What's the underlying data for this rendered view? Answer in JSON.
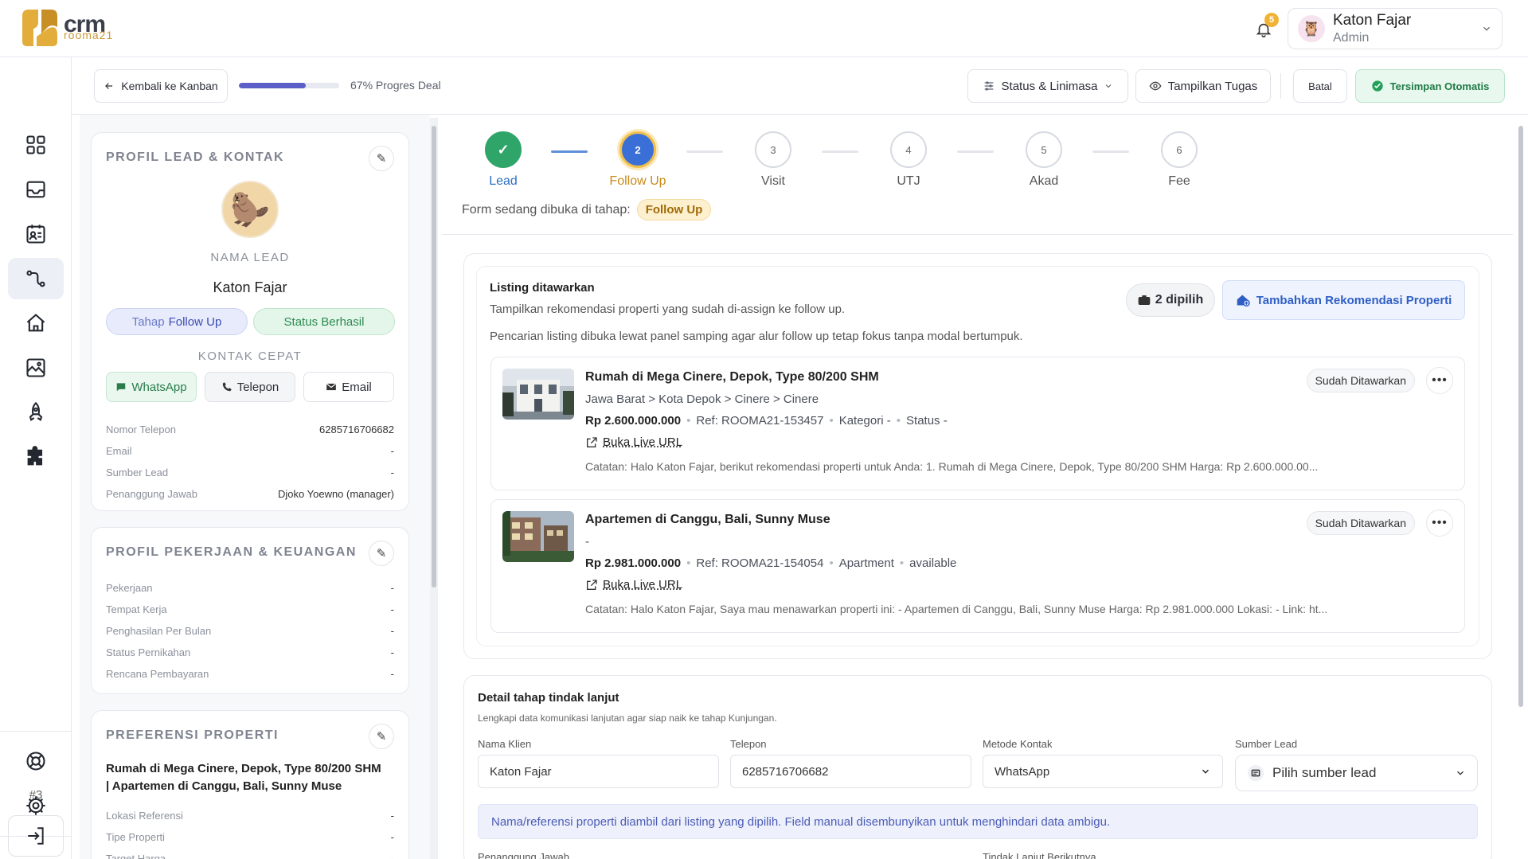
{
  "app": {
    "logo_main": "crm",
    "logo_sub": "rooma21"
  },
  "header": {
    "notif_count": "5",
    "user_name": "Katon Fajar",
    "user_role": "Admin"
  },
  "sidebar": {
    "footer_number": "#3"
  },
  "toolbar": {
    "back_label": "Kembali ke Kanban",
    "progress_percent": 67,
    "progress_label": "67% Progres Deal",
    "status_label": "Status & Linimasa",
    "tasks_label": "Tampilkan Tugas",
    "cancel_label": "Batal",
    "saved_label": "Tersimpan Otomatis"
  },
  "lead_profile": {
    "title": "PROFIL LEAD & KONTAK",
    "name_caption": "NAMA LEAD",
    "name": "Katon Fajar",
    "stage_prefix": "Tahap",
    "stage_value": "Follow Up",
    "status_badge": "Status Berhasil",
    "quick_contact_title": "KONTAK CEPAT",
    "whatsapp": "WhatsApp",
    "telepon": "Telepon",
    "email": "Email",
    "fields": [
      {
        "k": "Nomor Telepon",
        "v": "6285716706682"
      },
      {
        "k": "Email",
        "v": "-"
      },
      {
        "k": "Sumber Lead",
        "v": "-"
      },
      {
        "k": "Penanggung Jawab",
        "v": "Djoko Yoewno (manager)"
      }
    ]
  },
  "job_profile": {
    "title": "PROFIL PEKERJAAN & KEUANGAN",
    "fields": [
      {
        "k": "Pekerjaan",
        "v": "-"
      },
      {
        "k": "Tempat Kerja",
        "v": "-"
      },
      {
        "k": "Penghasilan Per Bulan",
        "v": "-"
      },
      {
        "k": "Status Pernikahan",
        "v": "-"
      },
      {
        "k": "Rencana Pembayaran",
        "v": "-"
      }
    ]
  },
  "property_pref": {
    "title": "PREFERENSI PROPERTI",
    "summary_line1": "Rumah di Mega Cinere, Depok, Type 80/200 SHM",
    "summary_line2": "| Apartemen di Canggu, Bali, Sunny Muse",
    "fields": [
      {
        "k": "Lokasi Referensi",
        "v": "-"
      },
      {
        "k": "Tipe Properti",
        "v": "-"
      },
      {
        "k": "Target Harga",
        "v": "-"
      }
    ]
  },
  "stepper": {
    "steps": [
      {
        "num": "✓",
        "label": "Lead",
        "state": "done"
      },
      {
        "num": "2",
        "label": "Follow Up",
        "state": "active"
      },
      {
        "num": "3",
        "label": "Visit",
        "state": "todo"
      },
      {
        "num": "4",
        "label": "UTJ",
        "state": "todo"
      },
      {
        "num": "5",
        "label": "Akad",
        "state": "todo"
      },
      {
        "num": "6",
        "label": "Fee",
        "state": "todo"
      }
    ],
    "open_prefix": "Form sedang dibuka di tahap:",
    "open_stage": "Follow Up"
  },
  "listings": {
    "title": "Listing ditawarkan",
    "subtitle": "Tampilkan rekomendasi properti yang sudah di-assign ke follow up.",
    "note": "Pencarian listing dibuka lewat panel samping agar alur follow up tetap fokus tanpa modal bertumpuk.",
    "selected_count": "2 dipilih",
    "add_button": "Tambahkan Rekomendasi Properti",
    "items": [
      {
        "title": "Rumah di Mega Cinere, Depok, Type 80/200 SHM",
        "location": "Jawa Barat > Kota Depok > Cinere > Cinere",
        "price": "Rp 2.600.000.000",
        "ref": "Ref: ROOMA21-153457",
        "cat": "Kategori -",
        "status": "Status -",
        "link": "Buka Live URL",
        "badge": "Sudah Ditawarkan",
        "note": "Catatan: Halo Katon Fajar, berikut rekomendasi properti untuk Anda: 1. Rumah di Mega Cinere, Depok, Type 80/200 SHM Harga: Rp 2.600.000.00..."
      },
      {
        "title": "Apartemen di Canggu, Bali, Sunny Muse",
        "location": "-",
        "price": "Rp 2.981.000.000",
        "ref": "Ref: ROOMA21-154054",
        "cat": "Apartment",
        "status": "available",
        "link": "Buka Live URL",
        "badge": "Sudah Ditawarkan",
        "note": "Catatan: Halo Katon Fajar, Saya mau menawarkan properti ini: - Apartemen di Canggu, Bali, Sunny Muse Harga: Rp 2.981.000.000 Lokasi: - Link: ht..."
      }
    ]
  },
  "detail": {
    "title": "Detail tahap tindak lanjut",
    "subtitle": "Lengkapi data komunikasi lanjutan agar siap naik ke tahap Kunjungan.",
    "client_label": "Nama Klien",
    "client_value": "Katon Fajar",
    "phone_label": "Telepon",
    "phone_value": "6285716706682",
    "method_label": "Metode Kontak",
    "method_value": "WhatsApp",
    "source_label": "Sumber Lead",
    "source_placeholder": "Pilih sumber lead",
    "banner": "Nama/referensi properti diambil dari listing yang dipilih. Field manual disembunyikan untuk menghindari data ambigu.",
    "pic_label": "Penanggung Jawab",
    "next_label": "Tindak Lanjut Berikutnya"
  }
}
